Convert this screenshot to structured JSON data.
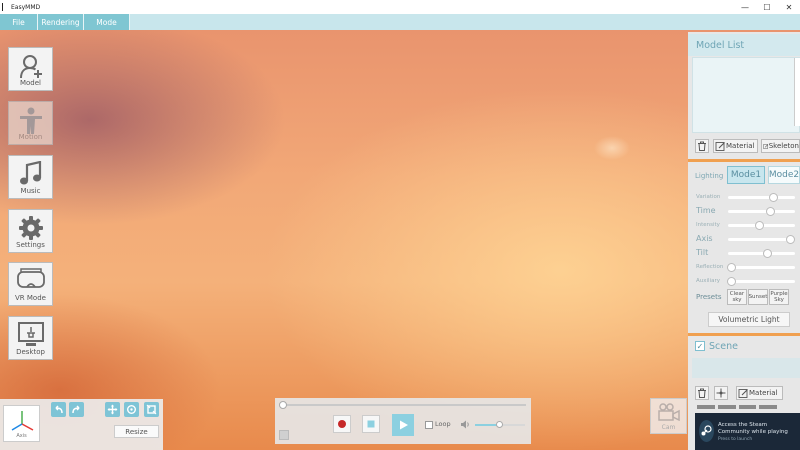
{
  "window": {
    "title": "EasyMMD"
  },
  "window_controls": {
    "minimize": "—",
    "maximize": "☐",
    "close": "✕"
  },
  "menu": {
    "file": "File",
    "rendering": "Rendering",
    "mode": "Mode"
  },
  "toolbar": {
    "model": "Model",
    "motion": "Motion",
    "music": "Music",
    "settings": "Settings",
    "vr_mode": "VR Mode",
    "desktop": "Desktop"
  },
  "view_panel": {
    "axis_label": "Axis",
    "resize": "Resize"
  },
  "playback": {
    "loop": "Loop",
    "volume": 0.45,
    "position": 0
  },
  "camera": {
    "label": "Cam"
  },
  "model_list": {
    "title": "Model List",
    "material": "Material",
    "skeleton": "Skeleton"
  },
  "lighting": {
    "label": "Lighting",
    "mode1": "Mode1",
    "mode2": "Mode2",
    "sliders": [
      {
        "label": "Variation",
        "value": 0.72
      },
      {
        "label": "Time",
        "value": 0.67
      },
      {
        "label": "Intensity",
        "value": 0.5
      },
      {
        "label": "Axis",
        "value": 1.0
      },
      {
        "label": "Tilt",
        "value": 0.63
      },
      {
        "label": "Reflection",
        "value": 0.05
      },
      {
        "label": "Auxiliary",
        "value": 0.05
      }
    ],
    "presets_label": "Presets",
    "presets": [
      "Clear sky",
      "Sunset",
      "Purple Sky"
    ],
    "volumetric": "Volumetric Light"
  },
  "scene": {
    "title": "Scene",
    "material": "Material",
    "checked": "✓"
  },
  "notification": {
    "text": "Access the Steam Community while playing",
    "sub": "Press  to launch"
  },
  "colors": {
    "accent": "#7fc6d2",
    "panel": "#e7e7e7",
    "divider": "#f0a050",
    "sky_top": "#e9946e",
    "sky_mid": "#f4b17a"
  }
}
